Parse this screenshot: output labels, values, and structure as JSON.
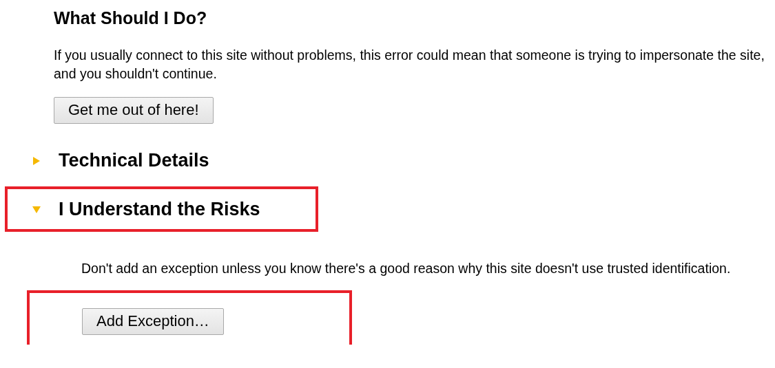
{
  "heading": "What Should I Do?",
  "intro": "If you usually connect to this site without problems, this error could mean that someone is trying to impersonate the site, and you shouldn't continue.",
  "escape_button": "Get me out of here!",
  "sections": [
    {
      "title": "Technical Details",
      "expanded": false,
      "highlighted": false
    },
    {
      "title": "I Understand the Risks",
      "expanded": true,
      "highlighted": true
    }
  ],
  "risk_text": "Don't add an exception unless you know there's a good reason why this site doesn't use trusted identification.",
  "exception_button": {
    "label": "Add Exception…",
    "highlighted": true
  }
}
